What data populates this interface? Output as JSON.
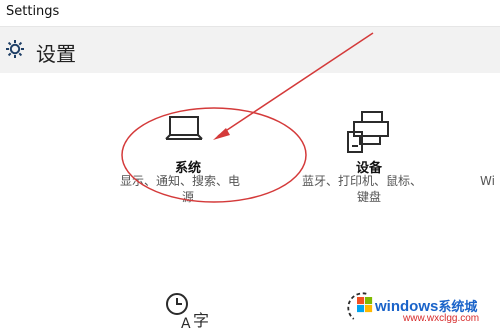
{
  "window": {
    "title": "Settings"
  },
  "header": {
    "title": "设置"
  },
  "tiles": [
    {
      "label": "系统",
      "desc_line1": "显示、通知、搜索、电",
      "desc_line2": "源"
    },
    {
      "label": "设备",
      "desc_line1": "蓝牙、打印机、鼠标、",
      "desc_line2": "键盘"
    },
    {
      "desc_line1": "Wi"
    }
  ],
  "bottom_tiles": [
    {
      "icon": "time-language-icon"
    },
    {
      "icon": "ease-of-access-icon"
    }
  ],
  "watermark": {
    "brand": "windows",
    "brand_cn": "系统城",
    "url": "www.wxclgg.com"
  },
  "colors": {
    "annotation": "#d43a3a",
    "header_bg": "#f2f2f2",
    "icon": "#2b2b2b"
  }
}
